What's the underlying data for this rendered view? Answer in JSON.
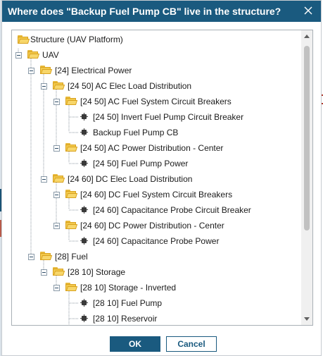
{
  "dialog": {
    "title": "Where does \"Backup Fuel Pump CB\" live in the structure?",
    "close_icon": "close-icon"
  },
  "tree": {
    "nodes": [
      {
        "label": "Structure (UAV Platform)",
        "type": "folder",
        "expandable": false
      },
      {
        "label": "UAV",
        "type": "folder",
        "expandable": true
      },
      {
        "label": "[24] Electrical Power",
        "type": "folder",
        "expandable": true
      },
      {
        "label": "[24 50] AC Elec Load Distribution",
        "type": "folder",
        "expandable": true
      },
      {
        "label": "[24 50] AC Fuel System Circuit Breakers",
        "type": "folder",
        "expandable": true
      },
      {
        "label": "[24 50] Invert Fuel Pump Circuit Breaker",
        "type": "item",
        "expandable": false
      },
      {
        "label": "Backup Fuel Pump CB",
        "type": "item",
        "expandable": false
      },
      {
        "label": "[24 50] AC Power Distribution - Center",
        "type": "folder",
        "expandable": true
      },
      {
        "label": "[24 50] Fuel Pump Power",
        "type": "item",
        "expandable": false
      },
      {
        "label": "[24 60] DC Elec Load Distribution",
        "type": "folder",
        "expandable": true
      },
      {
        "label": "[24 60] DC Fuel System Circuit Breakers",
        "type": "folder",
        "expandable": true
      },
      {
        "label": "[24 60] Capacitance Probe Circuit Breaker",
        "type": "item",
        "expandable": false
      },
      {
        "label": "[24 60] DC Power Distribution - Center",
        "type": "folder",
        "expandable": true
      },
      {
        "label": "[24 60] Capacitance Probe Power",
        "type": "item",
        "expandable": false
      },
      {
        "label": "[28] Fuel",
        "type": "folder",
        "expandable": true
      },
      {
        "label": "[28 10] Storage",
        "type": "folder",
        "expandable": true
      },
      {
        "label": "[28 10] Storage - Inverted",
        "type": "folder",
        "expandable": true
      },
      {
        "label": "[28 10] Fuel Pump",
        "type": "item",
        "expandable": false
      },
      {
        "label": "[28 10] Reservoir",
        "type": "item",
        "expandable": false
      }
    ]
  },
  "buttons": {
    "ok_label": "OK",
    "cancel_label": "Cancel"
  },
  "colors": {
    "titlebar": "#1a5a7f",
    "folder": "#f2c94c",
    "primary_button": "#1a5a7f"
  }
}
